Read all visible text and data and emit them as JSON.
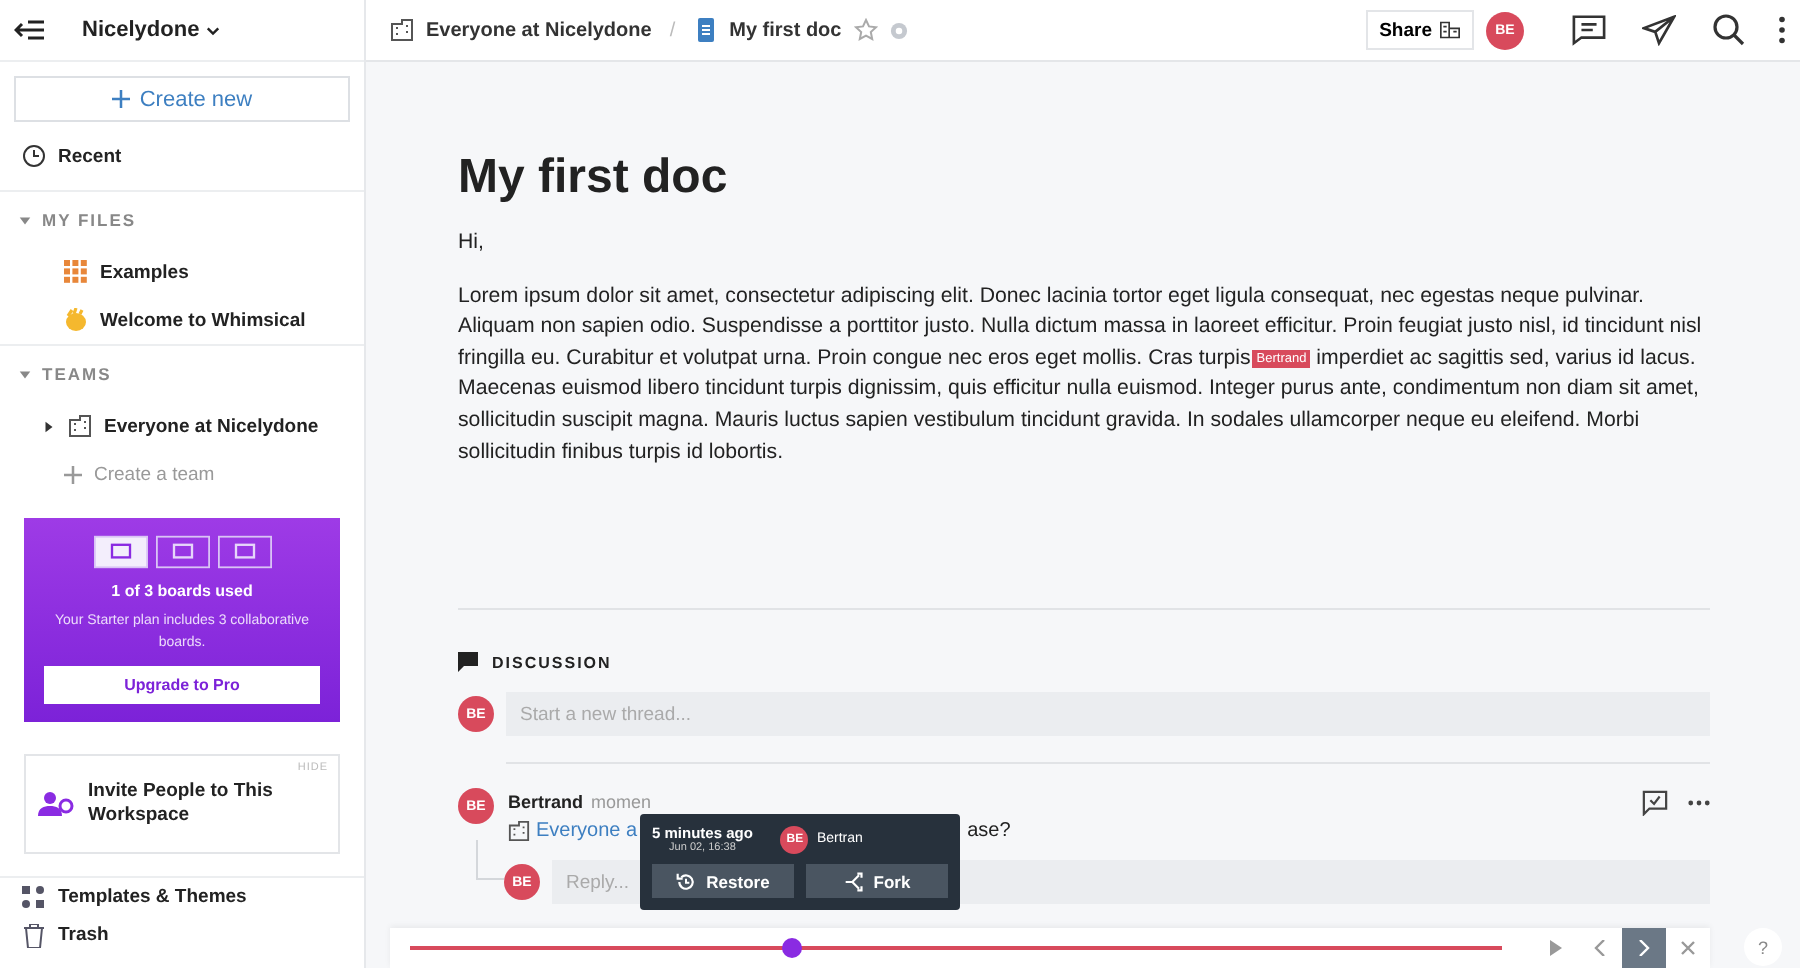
{
  "sidebar": {
    "workspace": "Nicelydone",
    "create_button": "Create new",
    "recent": "Recent",
    "sections": [
      {
        "title": "MY FILES",
        "expanded": true,
        "items": [
          {
            "kind": "grid",
            "label": "Examples"
          },
          {
            "kind": "wave",
            "label": "Welcome to Whimsical"
          }
        ]
      },
      {
        "title": "TEAMS",
        "expanded": true,
        "items": [
          {
            "kind": "team",
            "label": "Everyone at Nicelydone",
            "expanded": false
          }
        ],
        "action": "Create a team"
      }
    ],
    "plan_card": {
      "boards": [
        {
          "used": true
        },
        {
          "used": false
        },
        {
          "used": false
        }
      ],
      "title": "1 of 3 boards used",
      "text": "Your Starter plan includes 3 collaborative boards.",
      "button": "Upgrade to Pro"
    },
    "invite_card": {
      "hide": "HIDE",
      "text": "Invite People to This Workspace"
    },
    "footer_items": [
      {
        "kind": "templates",
        "label": "Templates & Themes"
      },
      {
        "kind": "trash",
        "label": "Trash"
      }
    ]
  },
  "breadcrumb": {
    "team": "Everyone at Nicelydone",
    "separator": "/",
    "doc": "My first doc",
    "starred": false
  },
  "toolbar": {
    "share": "Share",
    "avatar": "BE"
  },
  "doc": {
    "title": "My first doc",
    "greeting": "Hi,",
    "text_before_cursor": "Lorem ipsum dolor sit amet, consectetur adipiscing elit. Donec lacinia tortor eget ligula consequat, nec egestas neque pulvinar. Aliquam non sapien odio. Suspendisse a porttitor justo. Nulla dictum massa in laoreet efficitur. Proin feugiat justo nisl, id tincidunt nisl fringilla eu. Curabitur et volutpat urna. Proin congue nec eros eget mollis. Cras turpis",
    "cursor_user": "Bertrand",
    "text_after_cursor": "imperdiet ac sagittis sed, varius id lacus. Maecenas euismod libero tincidunt turpis dignissim, quis efficitur nulla euismod. Integer purus ante, condimentum non diam sit amet, sollicitudin suscipit magna. Mauris luctus sapien vestibulum tincidunt gravida. In sodales ullamcorper neque eu eleifend. Morbi sollicitudin finibus turpis id lobortis."
  },
  "discussion": {
    "title": "DISCUSSION",
    "avatar": "BE",
    "placeholder": "Start a new thread...",
    "comment": {
      "avatar": "BE",
      "author": "Bertrand",
      "time": "momen",
      "link": "Everyone a",
      "text": "ase?",
      "reply_avatar": "BE",
      "reply_placeholder": "Reply..."
    }
  },
  "history_popup": {
    "time": "5 minutes ago",
    "date": "Jun 02, 16:38",
    "avatar": "BE",
    "user": "Bertran",
    "buttons": [
      {
        "kind": "restore",
        "label": "Restore"
      },
      {
        "kind": "fork",
        "label": "Fork"
      }
    ]
  },
  "timeline": {
    "level": 0.35,
    "controls": [
      {
        "kind": "play",
        "selected": false
      },
      {
        "kind": "prev",
        "selected": false
      },
      {
        "kind": "next",
        "selected": true
      },
      {
        "kind": "close",
        "selected": false
      }
    ]
  },
  "help": "?"
}
